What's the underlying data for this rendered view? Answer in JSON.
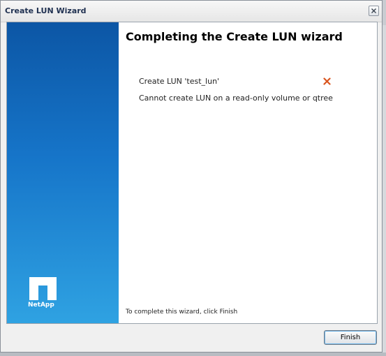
{
  "window": {
    "title": "Create LUN Wizard"
  },
  "banner": {
    "brand": "NetApp",
    "colors": {
      "top": "#0c56a5",
      "bottom": "#2fa2e2"
    }
  },
  "main": {
    "heading": "Completing the Create LUN wizard",
    "task": {
      "label": "Create LUN 'test_lun'",
      "status": "failed",
      "status_icon": "error-x-icon",
      "status_color": "#d9541e"
    },
    "error_message": "Cannot create LUN on a read-only volume or qtree",
    "footer_note": "To complete this wizard, click Finish"
  },
  "buttons": {
    "finish": "Finish"
  }
}
